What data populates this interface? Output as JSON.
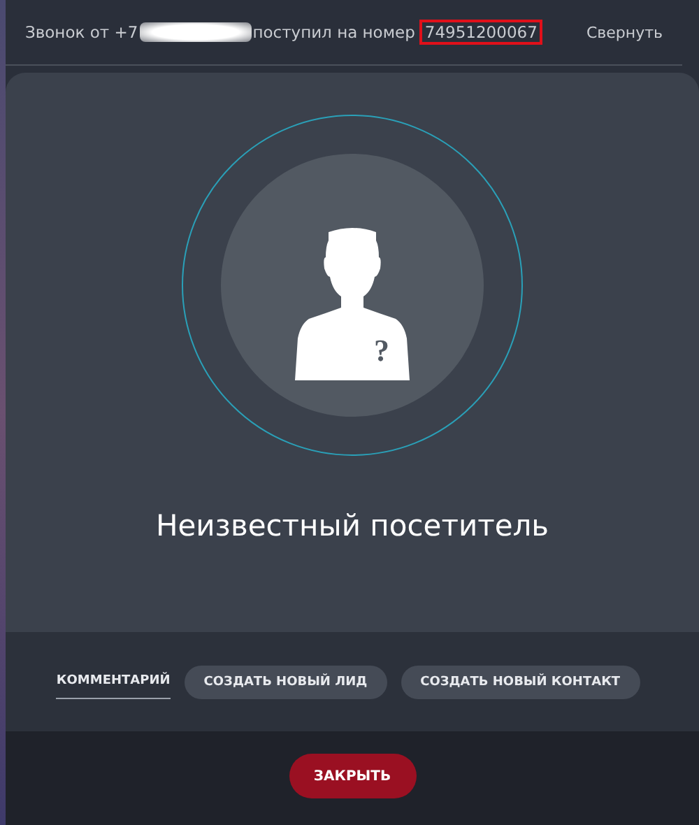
{
  "header": {
    "caller_prefix": "Звонок от +7",
    "caller_redacted": true,
    "middle": "поступил на номер",
    "number": "74951200067",
    "number_highlighted": true,
    "collapse": "Свернуть"
  },
  "visitor": {
    "name": "Неизвестный посетитель",
    "avatar_unknown": true,
    "avatar_mark": "?"
  },
  "tabs": [
    {
      "label": "КОММЕНТАРИЙ",
      "selected": true
    },
    {
      "label": "СОЗДАТЬ НОВЫЙ ЛИД",
      "selected": false
    },
    {
      "label": "СОЗДАТЬ НОВЫЙ КОНТАКТ",
      "selected": false
    }
  ],
  "close_button": "ЗАКРЫТЬ"
}
